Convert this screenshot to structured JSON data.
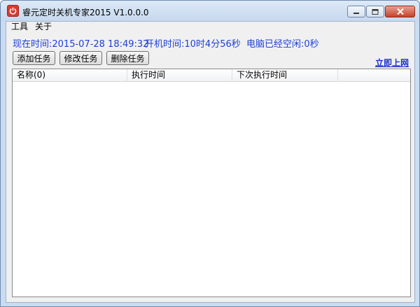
{
  "window": {
    "title": "睿元定时关机专家2015 V1.0.0.0"
  },
  "menu": {
    "items": [
      "工具",
      "关于"
    ]
  },
  "status": {
    "current_time": "现在时间:2015-07-28 18:49:32",
    "uptime": "开机时间:10时4分56秒",
    "idle": "电脑已经空闲:0秒"
  },
  "toolbar": {
    "add_label": "添加任务",
    "edit_label": "修改任务",
    "delete_label": "删除任务",
    "internet_link": "立即上网"
  },
  "table": {
    "columns": [
      "名称(0)",
      "执行时间",
      "下次执行时间",
      ""
    ],
    "rows": []
  },
  "colors": {
    "status_text": "#1d3fd6",
    "link": "#1a2ecf",
    "close_button": "#c4412c"
  }
}
